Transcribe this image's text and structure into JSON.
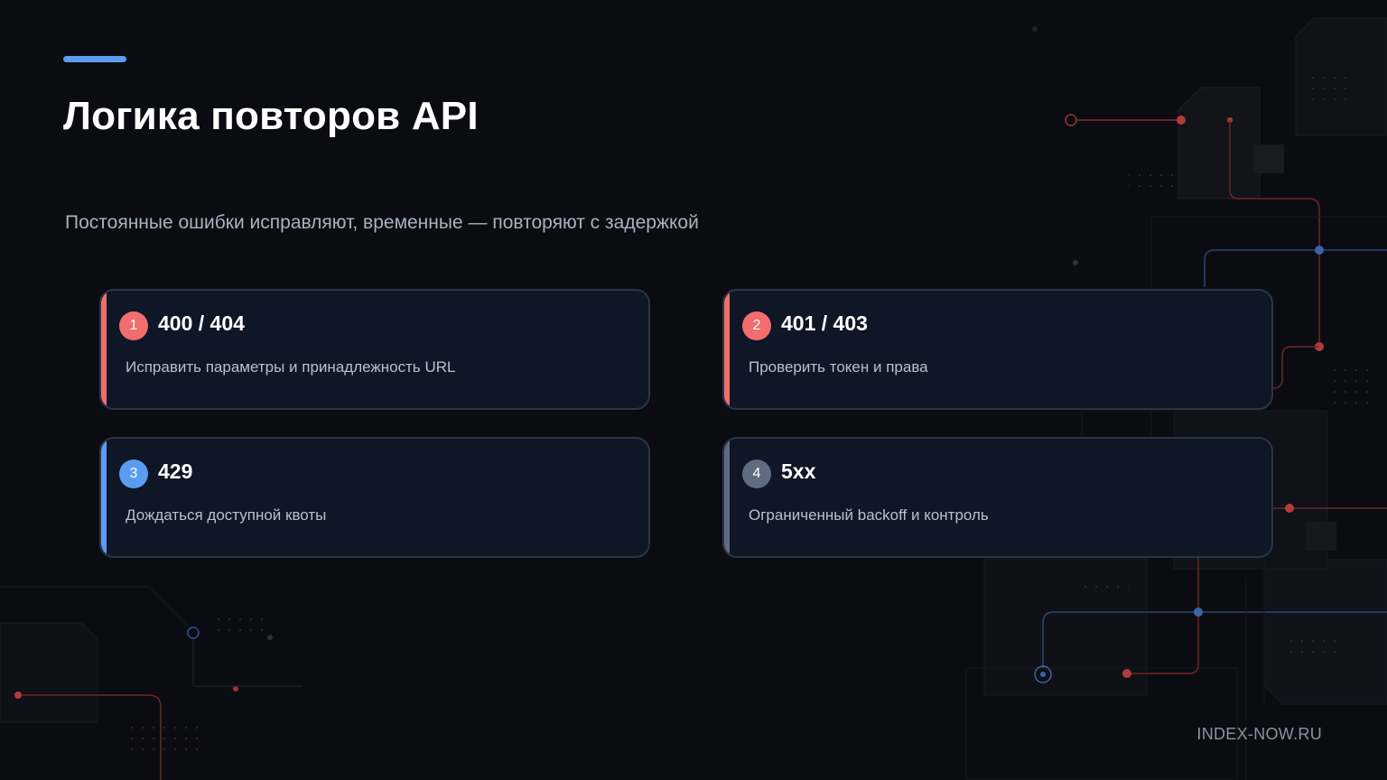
{
  "slide": {
    "title": "Логика повторов API",
    "subtitle": "Постоянные ошибки исправляют, временные — повторяют с задержкой",
    "footer": "INDEX-NOW.RU",
    "accent_color": "#5b9cf0"
  },
  "cards": [
    {
      "number": "1",
      "code": "400 / 404",
      "description": "Исправить параметры и принадлежность URL",
      "color": "#f26d6d"
    },
    {
      "number": "2",
      "code": "401 / 403",
      "description": "Проверить токен и права",
      "color": "#f26d6d"
    },
    {
      "number": "3",
      "code": "429",
      "description": "Дождаться доступной квоты",
      "color": "#5b9cf0"
    },
    {
      "number": "4",
      "code": "5xx",
      "description": "Ограниченный backoff и контроль",
      "color": "#5f6b80"
    }
  ]
}
